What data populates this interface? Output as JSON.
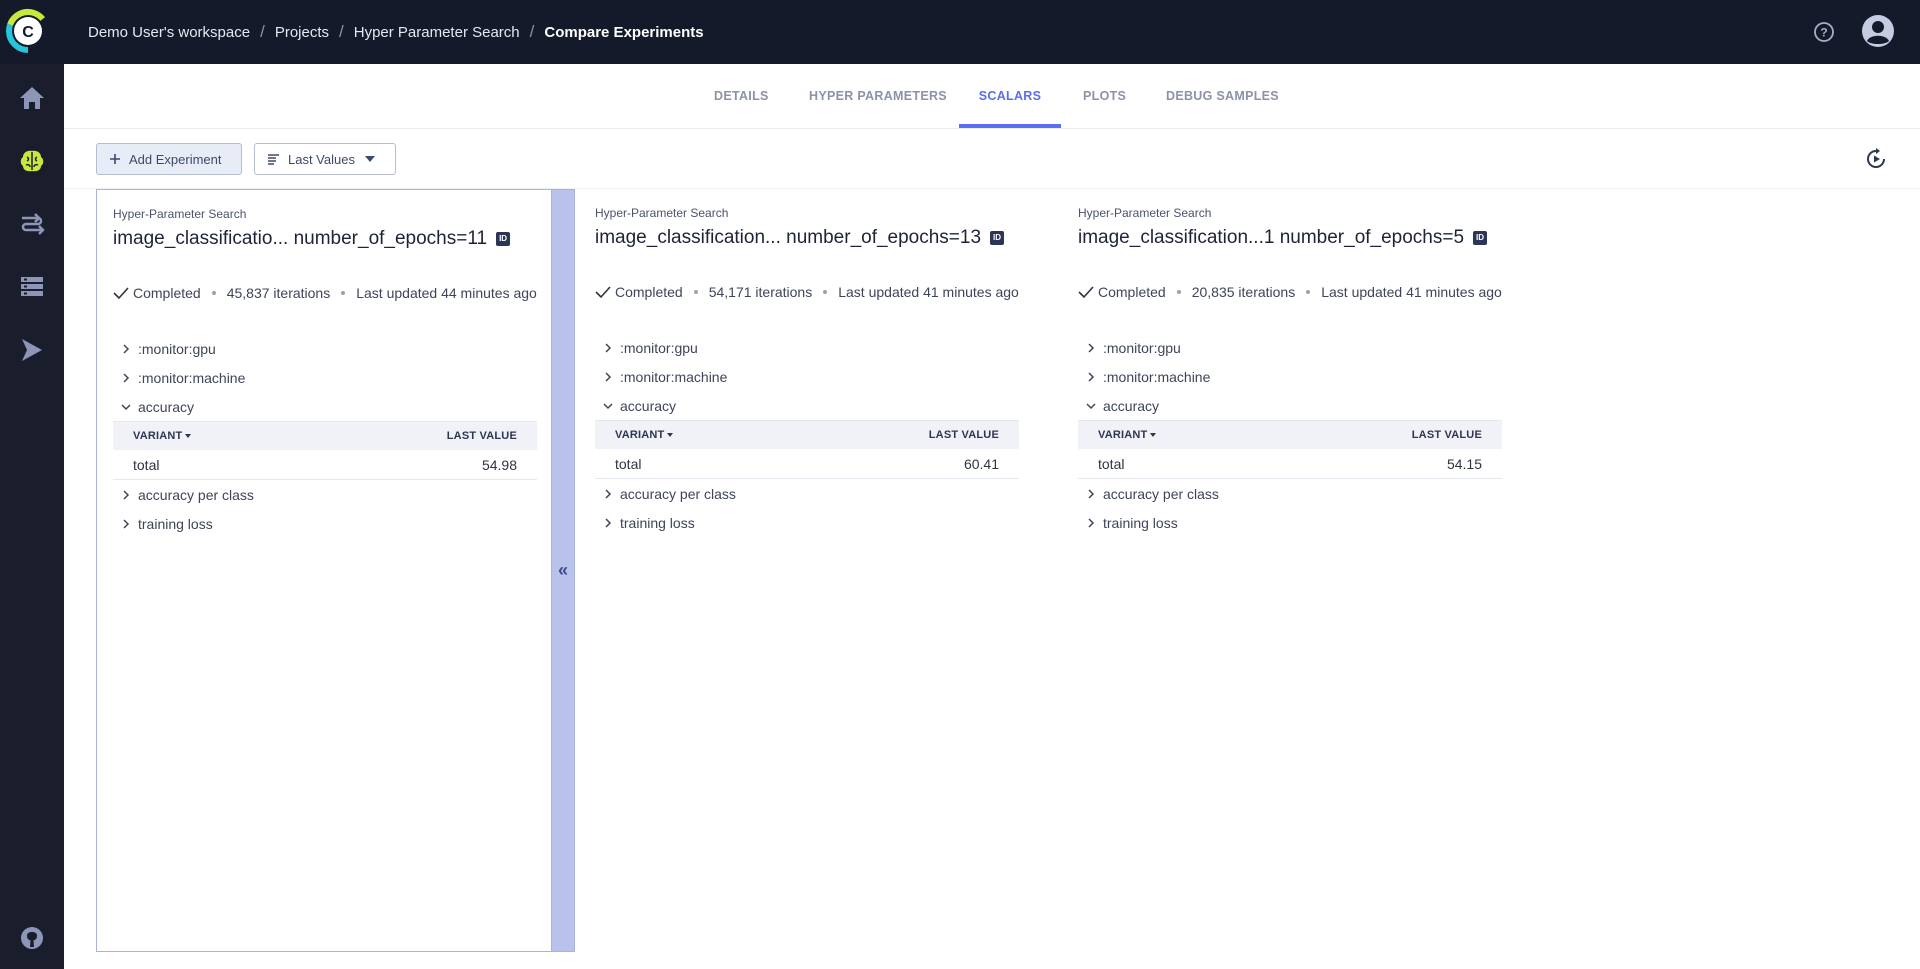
{
  "breadcrumb": {
    "workspace": "Demo User's workspace",
    "projects": "Projects",
    "project": "Hyper Parameter Search",
    "current": "Compare Experiments"
  },
  "tabs": [
    {
      "label": "DETAILS",
      "active": false
    },
    {
      "label": "HYPER PARAMETERS",
      "active": false
    },
    {
      "label": "SCALARS",
      "active": true
    },
    {
      "label": "PLOTS",
      "active": false
    },
    {
      "label": "DEBUG SAMPLES",
      "active": false
    }
  ],
  "toolbar": {
    "add_label": "Add Experiment",
    "values_label": "Last Values"
  },
  "sidebar": {
    "items": [
      {
        "icon": "home-icon"
      },
      {
        "icon": "brain-icon"
      },
      {
        "icon": "pipelines-icon"
      },
      {
        "icon": "datasets-icon"
      },
      {
        "icon": "orchestration-icon"
      },
      {
        "icon": "github-icon"
      }
    ]
  },
  "table_headers": {
    "variant": "VARIANT",
    "last_value": "LAST VALUE"
  },
  "experiments": [
    {
      "project": "Hyper-Parameter Search",
      "name": "image_classificatio... number_of_epochs=11",
      "id_badge": "ID",
      "status": "Completed",
      "iterations": "45,837 iterations",
      "updated": "Last updated 44 minutes ago",
      "metrics": {
        "gpu": ":monitor:gpu",
        "machine": ":monitor:machine",
        "accuracy": "accuracy",
        "variant": "total",
        "value": "54.98",
        "per_class": "accuracy per class",
        "loss": "training loss"
      }
    },
    {
      "project": "Hyper-Parameter Search",
      "name": "image_classification... number_of_epochs=13",
      "id_badge": "ID",
      "status": "Completed",
      "iterations": "54,171 iterations",
      "updated": "Last updated 41 minutes ago",
      "metrics": {
        "gpu": ":monitor:gpu",
        "machine": ":monitor:machine",
        "accuracy": "accuracy",
        "variant": "total",
        "value": "60.41",
        "per_class": "accuracy per class",
        "loss": "training loss"
      }
    },
    {
      "project": "Hyper-Parameter Search",
      "name": "image_classification...1 number_of_epochs=5",
      "id_badge": "ID",
      "status": "Completed",
      "iterations": "20,835 iterations",
      "updated": "Last updated 41 minutes ago",
      "metrics": {
        "gpu": ":monitor:gpu",
        "machine": ":monitor:machine",
        "accuracy": "accuracy",
        "variant": "total",
        "value": "54.15",
        "per_class": "accuracy per class",
        "loss": "training loss"
      }
    }
  ],
  "colors": {
    "accent": "#5a6ef0",
    "topbar": "#151a2b",
    "sidebar": "#1a1e2c",
    "brain": "#c8e83a"
  }
}
